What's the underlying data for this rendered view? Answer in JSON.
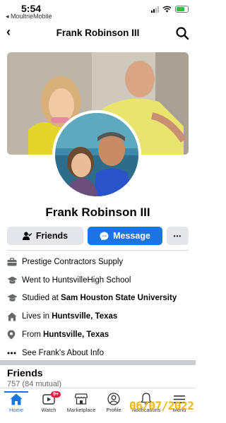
{
  "status_bar": {
    "time": "5:54",
    "back_app": "◂ MoultrieMobile"
  },
  "header": {
    "back_glyph": "‹",
    "title": "Frank Robinson III"
  },
  "profile": {
    "name": "Frank Robinson III"
  },
  "actions": {
    "friends_label": "Friends",
    "message_label": "Message",
    "more_label": "•••"
  },
  "info": [
    {
      "icon": "briefcase-icon",
      "prefix": "Prestige Contractors Supply",
      "bold": ""
    },
    {
      "icon": "graduation-cap-icon",
      "prefix": "Went to HuntsvilleHigh School",
      "bold": ""
    },
    {
      "icon": "graduation-cap-icon",
      "prefix": "Studied at ",
      "bold": "Sam Houston State University"
    },
    {
      "icon": "home-icon",
      "prefix": "Lives in ",
      "bold": "Huntsville, Texas"
    },
    {
      "icon": "location-pin-icon",
      "prefix": "From ",
      "bold": "Huntsville, Texas"
    },
    {
      "icon": "more-dots-icon",
      "prefix": "See Frank's About Info",
      "bold": ""
    }
  ],
  "friends": {
    "title": "Friends",
    "count": "757 (84 mutual)"
  },
  "tabbar": {
    "home": "Home",
    "watch": "Watch",
    "watch_badge": "9+",
    "marketplace": "Marketplace",
    "profile": "Profile",
    "notifications": "Notifications",
    "menu": "Menu"
  },
  "overlay": {
    "date": "06/07/2022"
  },
  "colors": {
    "accent": "#1b74e4",
    "badge": "#e41e3f",
    "datestamp": "#f2b705"
  }
}
